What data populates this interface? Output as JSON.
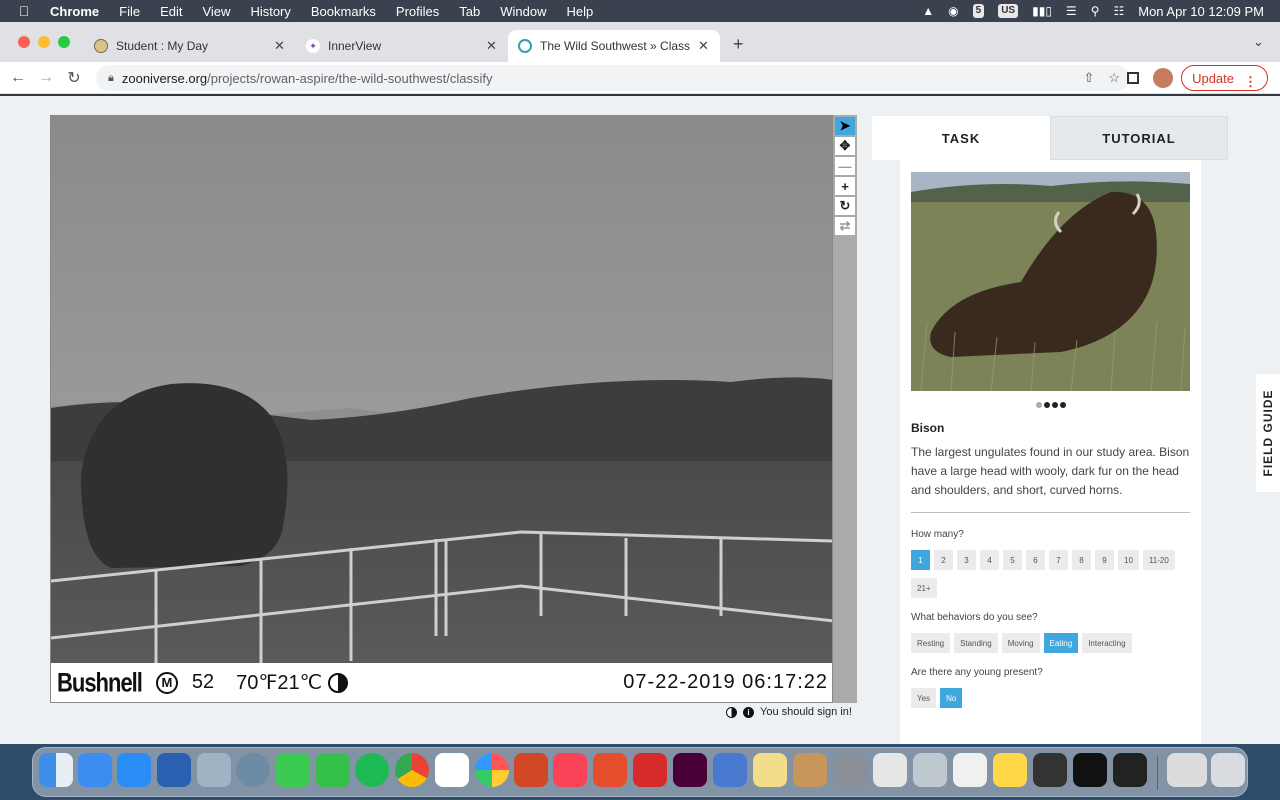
{
  "menubar": {
    "app": "Chrome",
    "items": [
      "File",
      "Edit",
      "View",
      "History",
      "Bookmarks",
      "Profiles",
      "Tab",
      "Window",
      "Help"
    ],
    "keyboard": "US",
    "clock": "Mon Apr 10  12:09 PM"
  },
  "tabs": [
    {
      "label": "Student : My Day"
    },
    {
      "label": "InnerView"
    },
    {
      "label": "The Wild Southwest » Classify"
    }
  ],
  "omnibox": {
    "host": "zooniverse.org",
    "path": "/projects/rowan-aspire/the-wild-southwest/classify"
  },
  "toolbar": {
    "update_label": "Update"
  },
  "camera": {
    "brand": "Bushnell",
    "mode": "M",
    "number": "52",
    "temperature": "70℉21℃",
    "datetime": "07-22-2019  06:17:22"
  },
  "signin_text": "You should sign in!",
  "task_tabs": {
    "task": "TASK",
    "tutorial": "TUTORIAL"
  },
  "species": {
    "name": "Bison",
    "description": "The largest ungulates found in our study area. Bison have a large head with wooly, dark fur on the head and shoulders, and short, curved horns."
  },
  "questions": [
    {
      "label": "How many?",
      "options": [
        "1",
        "2",
        "3",
        "4",
        "5",
        "6",
        "7",
        "8",
        "9",
        "10",
        "11-20",
        "21+"
      ],
      "selected": "1"
    },
    {
      "label": "What behaviors do you see?",
      "options": [
        "Resting",
        "Standing",
        "Moving",
        "Eating",
        "Interacting"
      ],
      "selected": "Eating"
    },
    {
      "label": "Are there any young present?",
      "options": [
        "Yes",
        "No"
      ],
      "selected": "No"
    }
  ],
  "field_guide": "FIELD GUIDE",
  "colors": {
    "accent": "#3fa6de",
    "update": "#d93025"
  }
}
